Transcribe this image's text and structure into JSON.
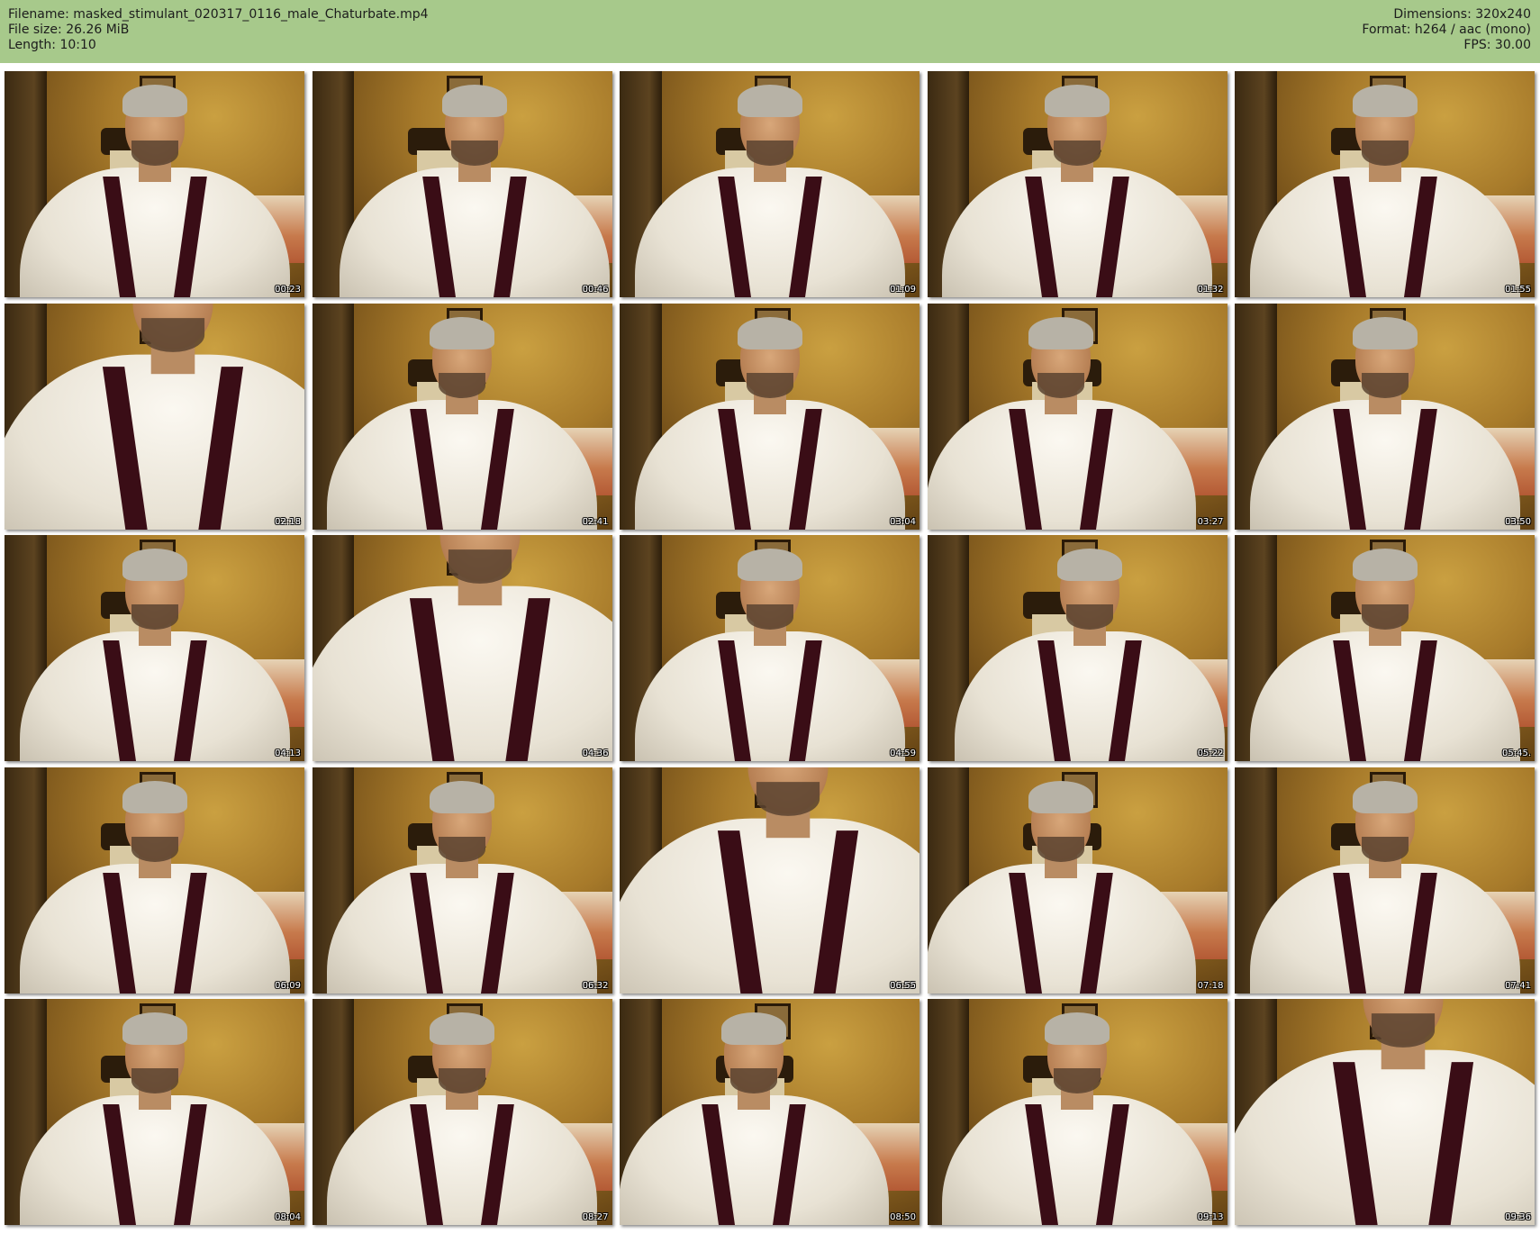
{
  "header": {
    "filename_label": "Filename: masked_stimulant_020317_0116_male_Chaturbate.mp4",
    "filesize_label": "File size: 26.26 MiB",
    "length_label": "Length: 10:10",
    "dimensions_label": "Dimensions: 320x240",
    "format_label": "Format: h264 / aac (mono)",
    "fps_label": "FPS: 30.00",
    "background_color": "#a7c98b"
  },
  "thumbnails": [
    {
      "timestamp": "00:23"
    },
    {
      "timestamp": "00:46"
    },
    {
      "timestamp": "01:09"
    },
    {
      "timestamp": "01:32"
    },
    {
      "timestamp": "01:55"
    },
    {
      "timestamp": "02:18"
    },
    {
      "timestamp": "02:41"
    },
    {
      "timestamp": "03:04"
    },
    {
      "timestamp": "03:27"
    },
    {
      "timestamp": "03:50"
    },
    {
      "timestamp": "04:13"
    },
    {
      "timestamp": "04:36"
    },
    {
      "timestamp": "04:59"
    },
    {
      "timestamp": "05:22"
    },
    {
      "timestamp": "05:45."
    },
    {
      "timestamp": "06:09"
    },
    {
      "timestamp": "06:32"
    },
    {
      "timestamp": "06:55"
    },
    {
      "timestamp": "07:18"
    },
    {
      "timestamp": "07:41"
    },
    {
      "timestamp": "08:04"
    },
    {
      "timestamp": "08:27"
    },
    {
      "timestamp": "08:50"
    },
    {
      "timestamp": "09:13"
    },
    {
      "timestamp": "09:36"
    }
  ]
}
